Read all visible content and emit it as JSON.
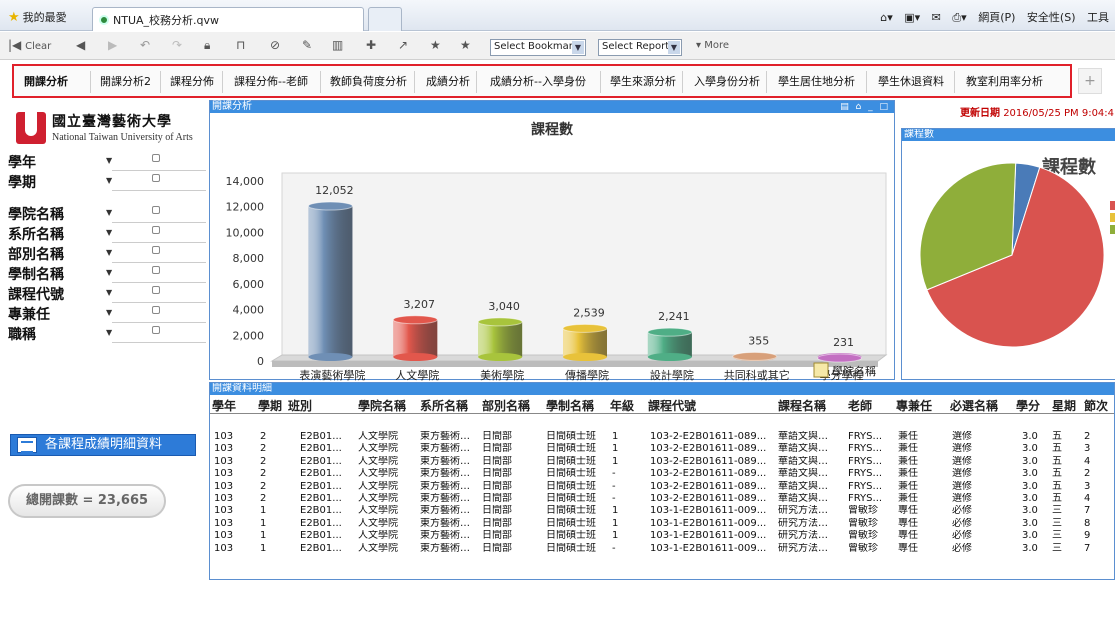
{
  "browser": {
    "favorites": "我的最愛",
    "tab_title": "NTUA_校務分析.qvw",
    "commands": [
      "網頁(P)",
      "安全性(S)",
      "工具"
    ]
  },
  "toolbar": {
    "clear": "Clear",
    "select_bookmark": "Select Bookmark",
    "select_report": "Select Report",
    "more": "More"
  },
  "sheet_tabs": [
    "開課分析",
    "開課分析2",
    "課程分佈",
    "課程分佈--老師",
    "教師負荷度分析",
    "成績分析",
    "成績分析--入學身份",
    "學生來源分析",
    "入學身份分析",
    "學生居住地分析",
    "學生休退資料",
    "教室利用率分析"
  ],
  "logo": {
    "name_cn": "國立臺灣藝術大學",
    "name_en": "National Taiwan University of Arts"
  },
  "filters": {
    "group1": [
      "學年",
      "學期"
    ],
    "group2": [
      "學院名稱",
      "系所名稱",
      "部別名稱",
      "學制名稱",
      "課程代號",
      "專兼任",
      "職稱"
    ]
  },
  "detail_button": "各課程成績明細資料",
  "total_courses": "總開課數 = 23,665",
  "update": {
    "label": "更新日期",
    "value": "2016/05/25 PM 9:04:4"
  },
  "chart_panel_caption": "開課分析",
  "pie_panel_caption": "課程數",
  "pie_title": "課程數",
  "table_caption": "開課資料明細",
  "colors": {
    "panel_border": "#5b8fd0",
    "caption_bg": "#3c8ee0",
    "highlight_red": "#e0202a",
    "date_red": "#c00000"
  },
  "chart_data": [
    {
      "type": "bar",
      "title": "課程數",
      "xlabel": "學院名稱",
      "ylabel": "",
      "ylim": [
        0,
        14000
      ],
      "yticks": [
        0,
        2000,
        4000,
        6000,
        8000,
        10000,
        12000,
        14000
      ],
      "ytick_labels": [
        "0",
        "2,000",
        "4,000",
        "6,000",
        "8,000",
        "10,000",
        "12,000",
        "14,000"
      ],
      "categories": [
        "表演藝術學院",
        "人文學院",
        "美術學院",
        "傳播學院",
        "設計學院",
        "共同科或其它",
        "學分學程"
      ],
      "values": [
        12052,
        3207,
        3040,
        2539,
        2241,
        355,
        231
      ],
      "value_labels": [
        "12,052",
        "3,207",
        "3,040",
        "2,539",
        "2,241",
        "355",
        "231"
      ],
      "bar_colors": [
        "#6f8fb5",
        "#e2574c",
        "#a8c43c",
        "#e8c23a",
        "#4fae86",
        "#d8a07a",
        "#c36fc2"
      ],
      "grid": false
    },
    {
      "type": "pie",
      "title": "課程數",
      "slices": [
        {
          "value": 12052,
          "color": "#d9534f"
        },
        {
          "value": 6000,
          "color": "#8fae3a"
        },
        {
          "value": 800,
          "color": "#4a7bb8"
        }
      ]
    }
  ],
  "table": {
    "headers": [
      "學年",
      "學期",
      "班別",
      "學院名稱",
      "系所名稱",
      "部別名稱",
      "學制名稱",
      "年級",
      "課程代號",
      "課程名稱",
      "老師",
      "專兼任",
      "必選名稱",
      "學分",
      "星期",
      "節次"
    ],
    "rows": [
      [
        "103",
        "2",
        "E2B01...",
        "人文學院",
        "東方藝術…",
        "日間部",
        "日間碩士班",
        "1",
        "103-2-E2B01611-089...",
        "華語文與…",
        "FRYS...",
        "兼任",
        "選修",
        "3.0",
        "五",
        "2"
      ],
      [
        "103",
        "2",
        "E2B01...",
        "人文學院",
        "東方藝術…",
        "日間部",
        "日間碩士班",
        "1",
        "103-2-E2B01611-089...",
        "華語文與…",
        "FRYS...",
        "兼任",
        "選修",
        "3.0",
        "五",
        "3"
      ],
      [
        "103",
        "2",
        "E2B01...",
        "人文學院",
        "東方藝術…",
        "日間部",
        "日間碩士班",
        "1",
        "103-2-E2B01611-089...",
        "華語文與…",
        "FRYS...",
        "兼任",
        "選修",
        "3.0",
        "五",
        "4"
      ],
      [
        "103",
        "2",
        "E2B01...",
        "人文學院",
        "東方藝術…",
        "日間部",
        "日間碩士班",
        "-",
        "103-2-E2B01611-089...",
        "華語文與…",
        "FRYS...",
        "兼任",
        "選修",
        "3.0",
        "五",
        "2"
      ],
      [
        "103",
        "2",
        "E2B01...",
        "人文學院",
        "東方藝術…",
        "日間部",
        "日間碩士班",
        "-",
        "103-2-E2B01611-089...",
        "華語文與…",
        "FRYS...",
        "兼任",
        "選修",
        "3.0",
        "五",
        "3"
      ],
      [
        "103",
        "2",
        "E2B01...",
        "人文學院",
        "東方藝術…",
        "日間部",
        "日間碩士班",
        "-",
        "103-2-E2B01611-089...",
        "華語文與…",
        "FRYS...",
        "兼任",
        "選修",
        "3.0",
        "五",
        "4"
      ],
      [
        "103",
        "1",
        "E2B01...",
        "人文學院",
        "東方藝術…",
        "日間部",
        "日間碩士班",
        "1",
        "103-1-E2B01611-009...",
        "研究方法…",
        "曾敏珍",
        "專任",
        "必修",
        "3.0",
        "三",
        "7"
      ],
      [
        "103",
        "1",
        "E2B01...",
        "人文學院",
        "東方藝術…",
        "日間部",
        "日間碩士班",
        "1",
        "103-1-E2B01611-009...",
        "研究方法…",
        "曾敏珍",
        "專任",
        "必修",
        "3.0",
        "三",
        "8"
      ],
      [
        "103",
        "1",
        "E2B01...",
        "人文學院",
        "東方藝術…",
        "日間部",
        "日間碩士班",
        "1",
        "103-1-E2B01611-009...",
        "研究方法…",
        "曾敏珍",
        "專任",
        "必修",
        "3.0",
        "三",
        "9"
      ],
      [
        "103",
        "1",
        "E2B01...",
        "人文學院",
        "東方藝術…",
        "日間部",
        "日間碩士班",
        "-",
        "103-1-E2B01611-009...",
        "研究方法…",
        "曾敏珍",
        "專任",
        "必修",
        "3.0",
        "三",
        "7"
      ]
    ]
  }
}
